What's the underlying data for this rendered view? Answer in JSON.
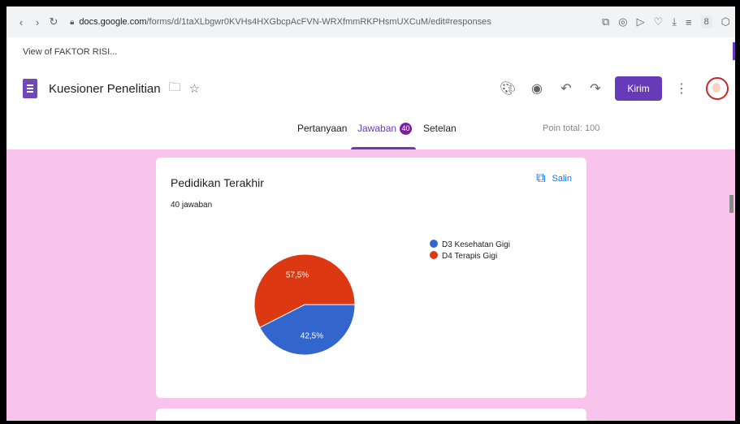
{
  "browser": {
    "url_host": "docs.google.com",
    "url_path": "/forms/d/1taXLbgwr0KVHs4HXGbcpAcFVN-WRXfmmRKPHsmUXCuM/edit#responses",
    "profile_initial": "8",
    "tab_label": "View of FAKTOR RISI..."
  },
  "header": {
    "title": "Kuesioner Penelitian",
    "send_label": "Kirim",
    "accent": "#673ab7"
  },
  "tabs": {
    "questions": "Pertanyaan",
    "responses": "Jawaban",
    "responses_count": "40",
    "settings": "Setelan",
    "points": "Poin total: 100"
  },
  "card": {
    "title": "Pedidikan Terakhir",
    "response_count": "40 jawaban",
    "copy_label": "Salin"
  },
  "chart_data": {
    "type": "pie",
    "labels": [
      "D3 Kesehatan Gigi",
      "D4 Terapis Gigi"
    ],
    "values": [
      42.5,
      57.5
    ],
    "value_labels": [
      "42,5%",
      "57,5%"
    ],
    "colors": [
      "#3366cc",
      "#dc3912"
    ],
    "legend_position": "right"
  },
  "colors": {
    "page_background": "#f8c3ec"
  }
}
